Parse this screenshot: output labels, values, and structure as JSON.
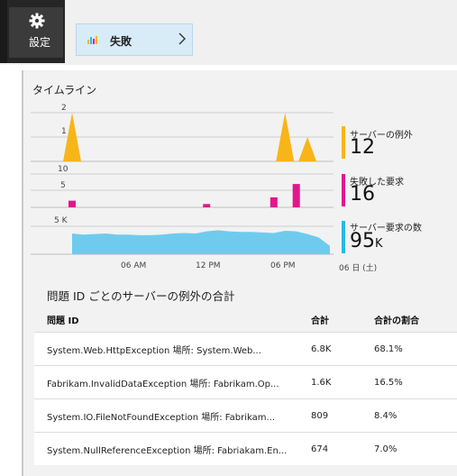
{
  "topbar": {
    "settings_label": "設定",
    "fail_tile_label": "失敗"
  },
  "timeline": {
    "title": "タイムライン",
    "x_ticks": [
      "06 AM",
      "12 PM",
      "06 PM",
      "06 日 (土)"
    ]
  },
  "metrics": [
    {
      "name": "サーバーの例外",
      "value": "12",
      "unit": "",
      "color": "#f7b518"
    },
    {
      "name": "失敗した要求",
      "value": "16",
      "unit": "",
      "color": "#e3168d"
    },
    {
      "name": "サーバー要求の数",
      "value": "95",
      "unit": "K",
      "color": "#27b8e6"
    }
  ],
  "chart_data": [
    {
      "type": "area",
      "title": "",
      "ylim": [
        0,
        2
      ],
      "y_ticks": [
        "2",
        "1"
      ],
      "series": [
        {
          "name": "サーバーの例外",
          "color": "#f7b518"
        }
      ],
      "x": [
        0,
        1,
        2,
        3,
        4,
        5,
        6,
        7,
        8,
        9,
        10,
        11,
        12,
        13,
        14,
        15,
        16,
        17,
        18,
        19,
        20,
        21,
        22,
        23
      ],
      "values": [
        2,
        0,
        0,
        0,
        0,
        0,
        0,
        0,
        0,
        0,
        0,
        0,
        0,
        0,
        0,
        0,
        0,
        0,
        0,
        2,
        0,
        1,
        0,
        0
      ]
    },
    {
      "type": "bar",
      "title": "",
      "ylim": [
        0,
        10
      ],
      "y_ticks": [
        "10",
        "5"
      ],
      "series": [
        {
          "name": "失敗した要求",
          "color": "#e3168d"
        }
      ],
      "x": [
        0,
        1,
        2,
        3,
        4,
        5,
        6,
        7,
        8,
        9,
        10,
        11,
        12,
        13,
        14,
        15,
        16,
        17,
        18,
        19,
        20,
        21,
        22,
        23
      ],
      "values": [
        2,
        0,
        0,
        0,
        0,
        0,
        0,
        0,
        0,
        0,
        0,
        0,
        1,
        0,
        0,
        0,
        0,
        0,
        3,
        0,
        7,
        0,
        0,
        0
      ]
    },
    {
      "type": "area",
      "title": "",
      "ylim": [
        0,
        5000
      ],
      "y_ticks": [
        "5 K"
      ],
      "series": [
        {
          "name": "サーバー要求の数",
          "color": "#6fcbee"
        }
      ],
      "x": [
        0,
        1,
        2,
        3,
        4,
        5,
        6,
        7,
        8,
        9,
        10,
        11,
        12,
        13,
        14,
        15,
        16,
        17,
        18,
        19,
        20,
        21,
        22,
        23
      ],
      "values": [
        3700,
        3500,
        3600,
        3700,
        3500,
        3500,
        3400,
        3400,
        3500,
        3700,
        3800,
        3700,
        4100,
        4300,
        4100,
        4000,
        4000,
        3900,
        3800,
        4200,
        4100,
        3600,
        3000,
        1500
      ]
    }
  ],
  "exceptions": {
    "section_title": "問題 ID ごとのサーバーの例外の合計",
    "headers": [
      "問題 ID",
      "合計",
      "合計の割合"
    ],
    "rows": [
      [
        "System.Web.HttpException 場所: System.Web...",
        "6.8K",
        "68.1%"
      ],
      [
        "Fabrikam.InvalidDataException 場所: Fabrikam.Op...",
        "1.6K",
        "16.5%"
      ],
      [
        "System.IO.FileNotFoundException 場所: Fabrikam...",
        "809",
        "8.4%"
      ],
      [
        "System.NullReferenceException 場所: Fabriakam.En...",
        "674",
        "7.0%"
      ]
    ]
  }
}
